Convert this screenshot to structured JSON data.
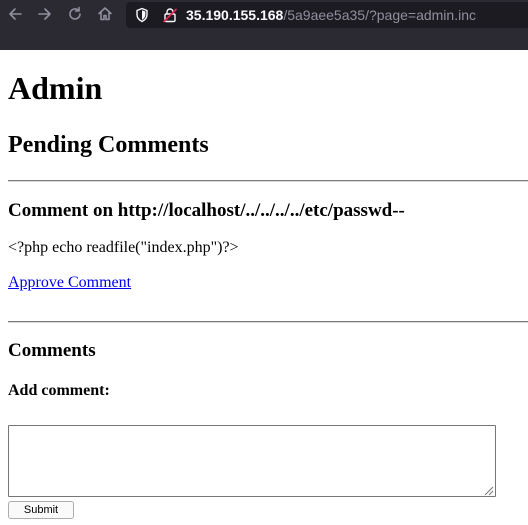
{
  "browser": {
    "url_host": "35.190.155.168",
    "url_path": "/5a9aee5a35/?page=admin.inc",
    "icons": [
      "back-icon",
      "forward-icon",
      "reload-icon",
      "home-icon",
      "shield-icon",
      "insecure-lock-icon"
    ]
  },
  "page": {
    "title": "Admin",
    "section_title": "Pending Comments",
    "pending_comment": {
      "heading": "Comment on http://localhost/../../../../etc/passwd--",
      "body": "<?php echo readfile(\"index.php\")?>",
      "approve_link": "Approve Comment"
    },
    "comments_heading": "Comments",
    "add_comment_label": "Add comment:",
    "comment_textarea_value": "",
    "submit_label": "Submit"
  }
}
